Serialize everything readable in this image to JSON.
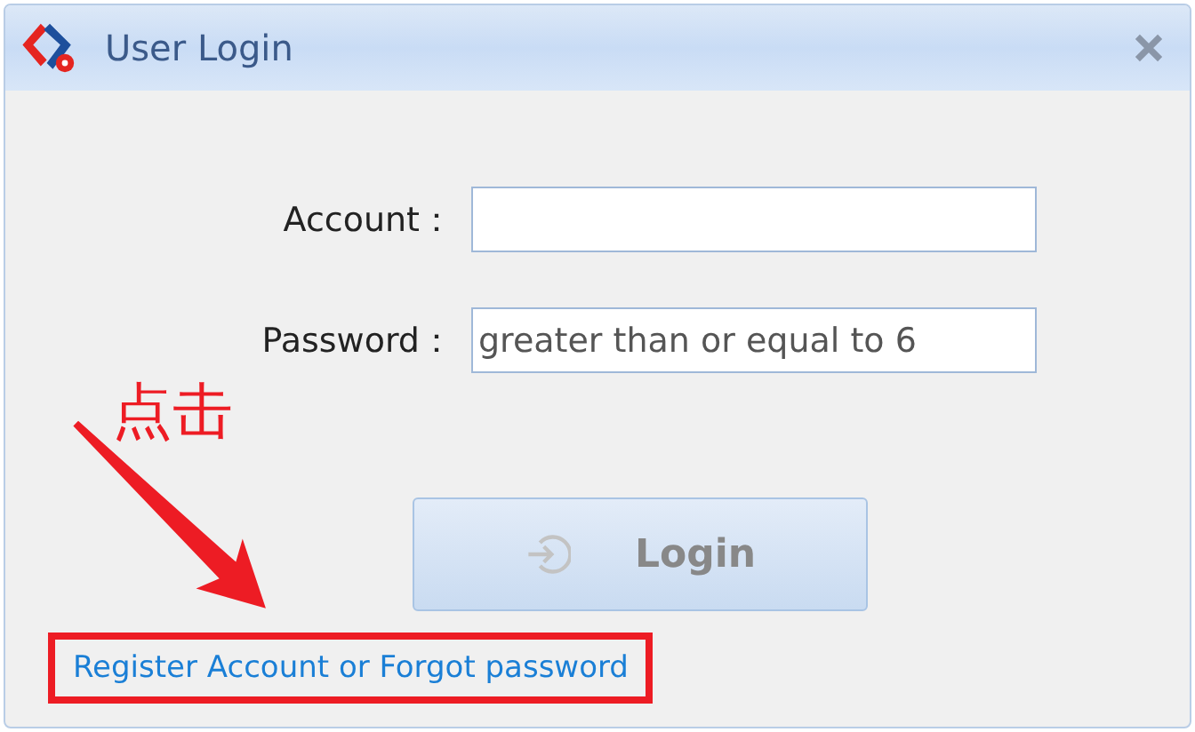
{
  "window": {
    "title": "User Login"
  },
  "fields": [
    {
      "label": "Account："
    },
    {
      "label": "Password：",
      "placeholder": "greater than or equal to 6"
    }
  ],
  "login_button": {
    "label": "Login",
    "disabled": true
  },
  "link": "Register Account or Forgot password",
  "annotation": {
    "text": "点击",
    "highlighted": true
  }
}
